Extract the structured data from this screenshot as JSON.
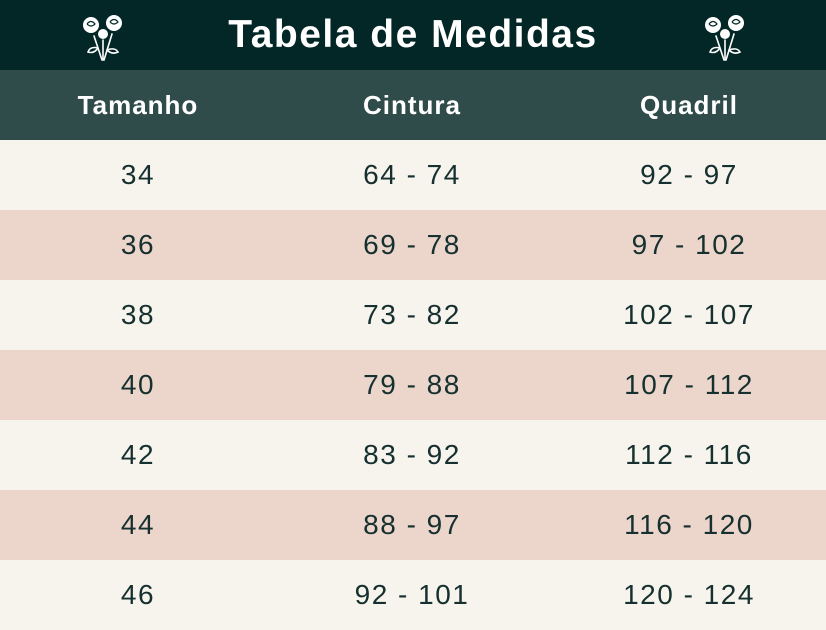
{
  "title": "Tabela de Medidas",
  "icons": {
    "left": "rose-bouquet-icon",
    "right": "rose-bouquet-icon"
  },
  "colors": {
    "title_bg": "#022726",
    "header_bg": "#2f4c4b",
    "row_light": "#f7f4ee",
    "row_pink": "#ecd5cb",
    "text": "#16302f"
  },
  "columns": [
    "Tamanho",
    "Cintura",
    "Quadril"
  ],
  "rows": [
    [
      "34",
      "64 - 74",
      "92 - 97"
    ],
    [
      "36",
      "69 - 78",
      "97 - 102"
    ],
    [
      "38",
      "73 - 82",
      "102 - 107"
    ],
    [
      "40",
      "79 - 88",
      "107 - 112"
    ],
    [
      "42",
      "83 - 92",
      "112 - 116"
    ],
    [
      "44",
      "88 - 97",
      "116 - 120"
    ],
    [
      "46",
      "92 - 101",
      "120 - 124"
    ]
  ]
}
